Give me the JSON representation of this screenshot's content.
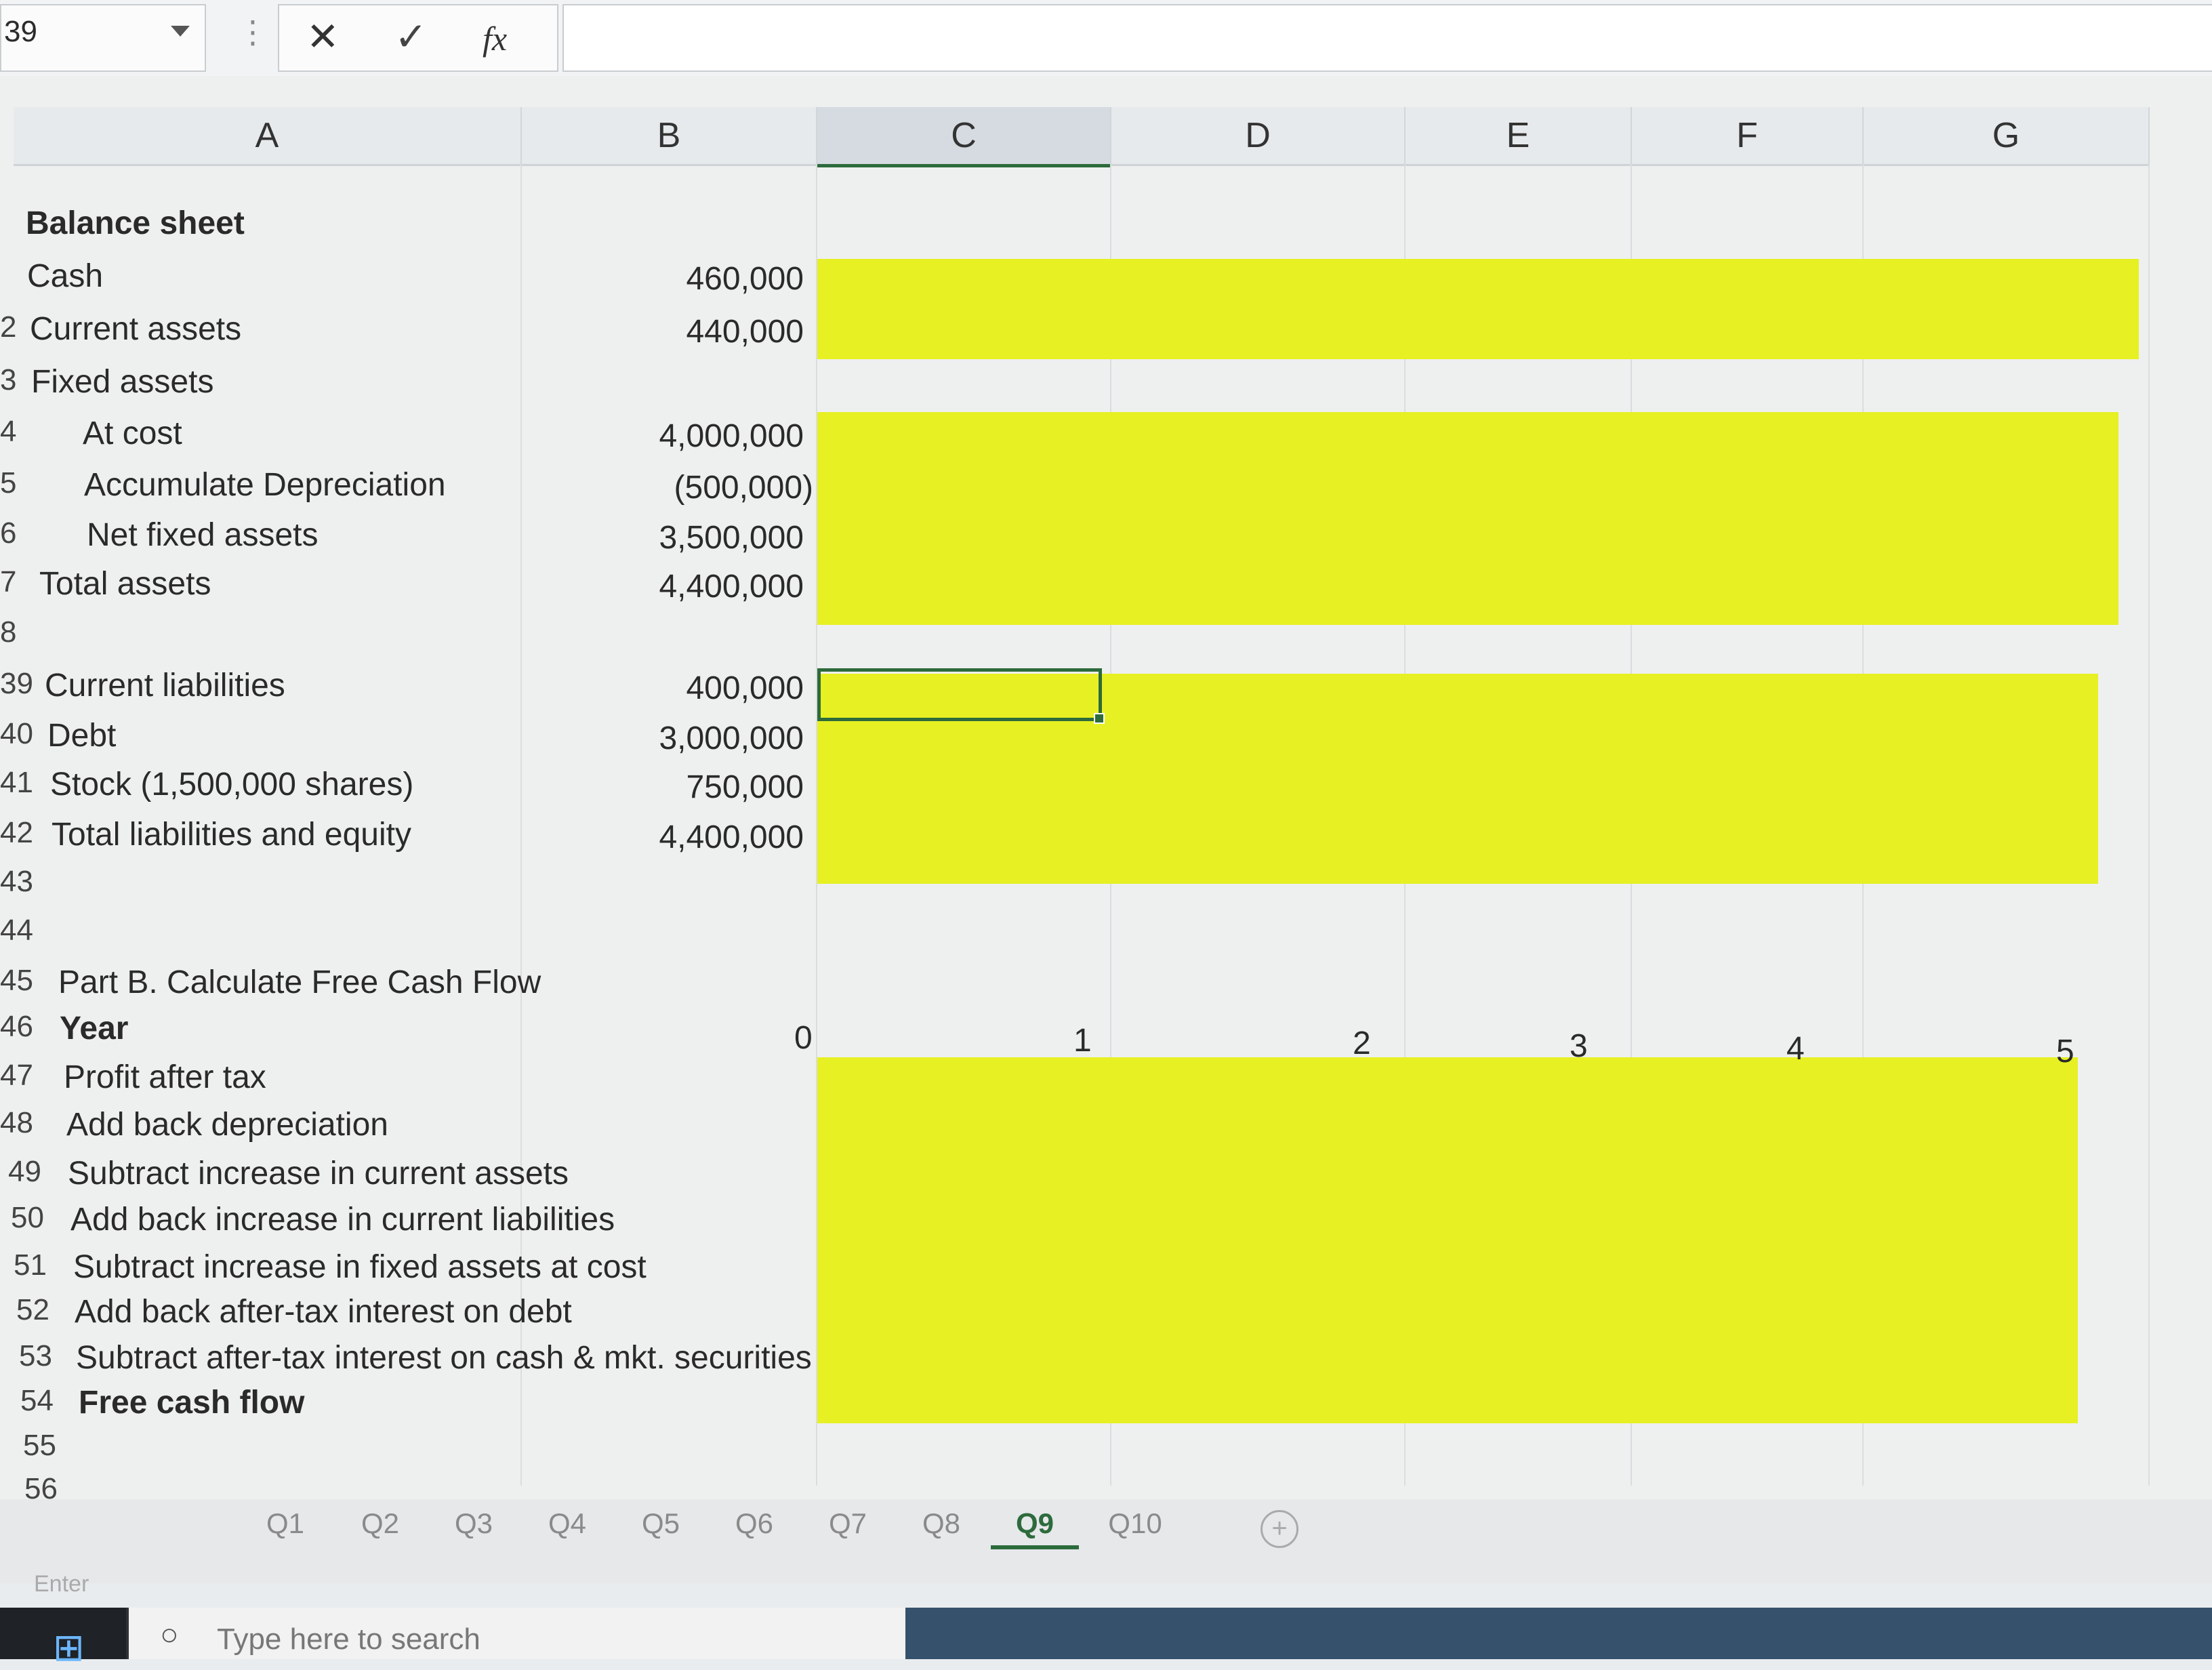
{
  "formula_bar": {
    "name_box": "39",
    "cancel_icon": "✕",
    "enter_icon": "✓",
    "fx_label": "fx",
    "formula": ""
  },
  "columns": [
    "A",
    "B",
    "C",
    "D",
    "E",
    "F",
    "G"
  ],
  "selected_column": "C",
  "rows": [
    {
      "num": "",
      "label": "Balance sheet",
      "value": "",
      "bold": true
    },
    {
      "num": "",
      "label": "Cash",
      "value": "460,000"
    },
    {
      "num": "2",
      "label": "Current assets",
      "value": "440,000"
    },
    {
      "num": "3",
      "label": "Fixed assets",
      "value": ""
    },
    {
      "num": "4",
      "label": "At cost",
      "value": "4,000,000",
      "indent": true
    },
    {
      "num": "5",
      "label": "Accumulate Depreciation",
      "value": "(500,000)",
      "indent": true
    },
    {
      "num": "6",
      "label": "Net fixed assets",
      "value": "3,500,000",
      "indent": true
    },
    {
      "num": "7",
      "label": "Total assets",
      "value": "4,400,000"
    },
    {
      "num": "8",
      "label": "",
      "value": ""
    },
    {
      "num": "39",
      "label": "Current liabilities",
      "value": "400,000"
    },
    {
      "num": "40",
      "label": "Debt",
      "value": "3,000,000"
    },
    {
      "num": "41",
      "label": "Stock (1,500,000 shares)",
      "value": "750,000"
    },
    {
      "num": "42",
      "label": "Total liabilities and equity",
      "value": "4,400,000"
    },
    {
      "num": "43",
      "label": "",
      "value": ""
    },
    {
      "num": "44",
      "label": "",
      "value": ""
    },
    {
      "num": "45",
      "label": "Part B. Calculate Free Cash Flow",
      "value": ""
    },
    {
      "num": "46",
      "label": "Year",
      "value": "",
      "bold": true
    },
    {
      "num": "47",
      "label": "Profit after tax",
      "value": ""
    },
    {
      "num": "48",
      "label": "Add back depreciation",
      "value": ""
    },
    {
      "num": "49",
      "label": "Subtract increase in current assets",
      "value": ""
    },
    {
      "num": "50",
      "label": "Add back increase in current liabilities",
      "value": ""
    },
    {
      "num": "51",
      "label": "Subtract increase in fixed assets at cost",
      "value": ""
    },
    {
      "num": "52",
      "label": "Add back after-tax interest on debt",
      "value": ""
    },
    {
      "num": "53",
      "label": "Subtract after-tax interest on cash & mkt. securities",
      "value": ""
    },
    {
      "num": "54",
      "label": "Free cash flow",
      "value": "",
      "bold": true
    },
    {
      "num": "55",
      "label": "",
      "value": ""
    },
    {
      "num": "56",
      "label": "",
      "value": ""
    }
  ],
  "years": [
    "0",
    "1",
    "2",
    "3",
    "4",
    "5"
  ],
  "sheet_tabs": [
    "Q1",
    "Q2",
    "Q3",
    "Q4",
    "Q5",
    "Q6",
    "Q7",
    "Q8",
    "Q9",
    "Q10"
  ],
  "active_tab": "Q9",
  "status_mode": "Enter",
  "taskbar": {
    "search_placeholder": "Type here to search"
  },
  "colors": {
    "highlight": "#e7f022",
    "selection": "#2d6b3c"
  }
}
